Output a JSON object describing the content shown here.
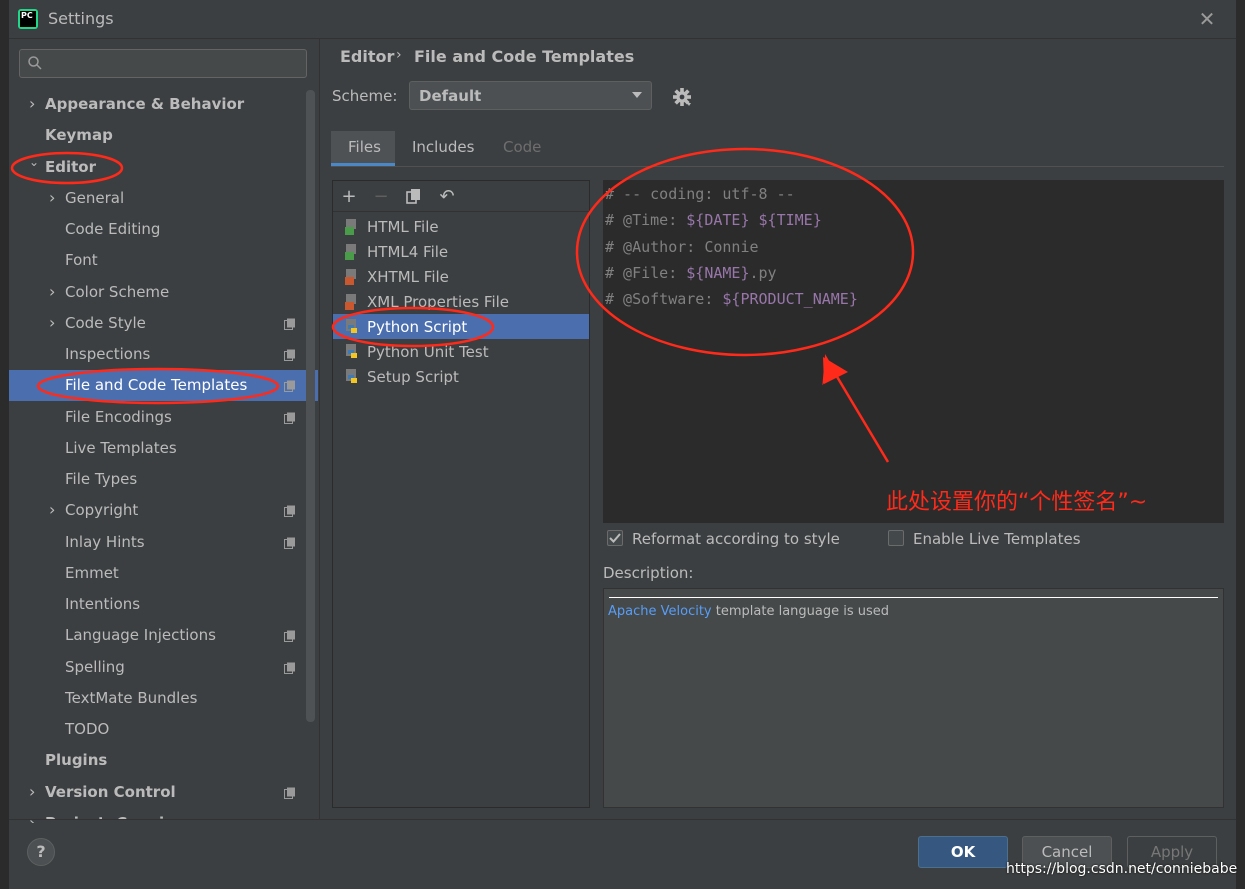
{
  "window": {
    "title": "Settings",
    "logo_text": "PC"
  },
  "sidebar": {
    "search_placeholder": "",
    "items": [
      {
        "label": "Appearance & Behavior",
        "bold": true,
        "arrow": "›"
      },
      {
        "label": "Keymap",
        "bold": true
      },
      {
        "label": "Editor",
        "bold": true,
        "arrow": "⌄"
      },
      {
        "label": "General",
        "arrow": "›"
      },
      {
        "label": "Code Editing"
      },
      {
        "label": "Font"
      },
      {
        "label": "Color Scheme",
        "arrow": "›"
      },
      {
        "label": "Code Style",
        "arrow": "›",
        "project": true
      },
      {
        "label": "Inspections",
        "project": true
      },
      {
        "label": "File and Code Templates",
        "project": true,
        "selected": true
      },
      {
        "label": "File Encodings",
        "project": true
      },
      {
        "label": "Live Templates"
      },
      {
        "label": "File Types"
      },
      {
        "label": "Copyright",
        "arrow": "›",
        "project": true
      },
      {
        "label": "Inlay Hints",
        "project": true
      },
      {
        "label": "Emmet"
      },
      {
        "label": "Intentions"
      },
      {
        "label": "Language Injections",
        "project": true
      },
      {
        "label": "Spelling",
        "project": true
      },
      {
        "label": "TextMate Bundles"
      },
      {
        "label": "TODO"
      },
      {
        "label": "Plugins",
        "bold": true
      },
      {
        "label": "Version Control",
        "bold": true,
        "arrow": "›",
        "project": true
      },
      {
        "label": "Project: Connie",
        "bold": true,
        "arrow": "›"
      }
    ]
  },
  "breadcrumb": {
    "parent": "Editor",
    "separator": "›",
    "current": "File and Code Templates"
  },
  "scheme": {
    "label": "Scheme:",
    "value": "Default"
  },
  "tabs": [
    {
      "label": "Files",
      "active": true
    },
    {
      "label": "Includes"
    },
    {
      "label": "Code",
      "disabled": true
    }
  ],
  "toolbar": {
    "add": "+",
    "remove": "−",
    "copy": "copy-icon",
    "reset": "↶"
  },
  "files": [
    {
      "name": "HTML File",
      "icon": "html-file-icon"
    },
    {
      "name": "HTML4 File",
      "icon": "html-file-icon"
    },
    {
      "name": "XHTML File",
      "icon": "xhtml-file-icon"
    },
    {
      "name": "XML Properties File",
      "icon": "xml-file-icon"
    },
    {
      "name": "Python Script",
      "icon": "python-icon",
      "selected": true
    },
    {
      "name": "Python Unit Test",
      "icon": "python-icon"
    },
    {
      "name": "Setup Script",
      "icon": "python-icon"
    }
  ],
  "editor": {
    "lines": [
      {
        "text": "# -- coding: utf-8 --",
        "var": "",
        "suffix": ""
      },
      {
        "text": "# @Time: ",
        "var": "${DATE} ${TIME}",
        "suffix": ""
      },
      {
        "text": "# @Author: Connie",
        "var": "",
        "suffix": ""
      },
      {
        "text": "# @File: ",
        "var": "${NAME}",
        "suffix": ".py"
      },
      {
        "text": "# @Software: ",
        "var": "${PRODUCT_NAME}",
        "suffix": ""
      }
    ],
    "annotation": "此处设置你的“个性签名”~"
  },
  "options": {
    "reformat_label": "Reformat according to style",
    "reformat_checked": true,
    "live_label": "Enable Live Templates",
    "live_checked": false
  },
  "description": {
    "label": "Description:",
    "link_text": "Apache Velocity",
    "text": " template language is used"
  },
  "buttons": {
    "help": "?",
    "ok": "OK",
    "cancel": "Cancel",
    "apply": "Apply"
  },
  "watermark": "https://blog.csdn.net/conniebabe",
  "colors": {
    "accent": "#4b6eaf",
    "annotation": "#ff2a1a",
    "background": "#3c3f41",
    "editor_bg": "#2b2b2b"
  }
}
